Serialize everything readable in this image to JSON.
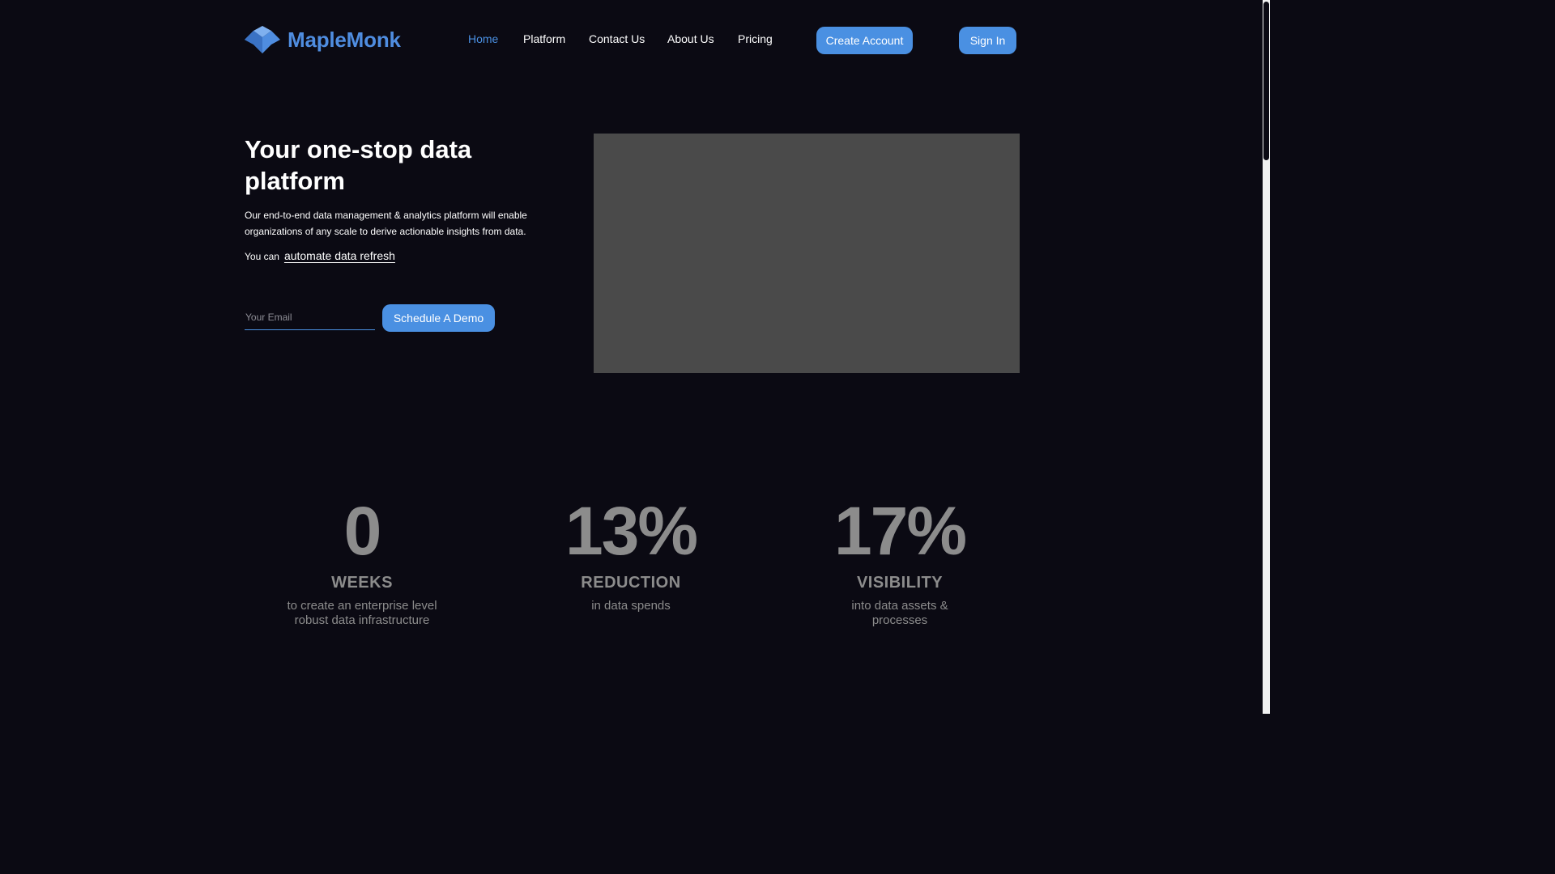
{
  "header": {
    "brand": "MapleMonk",
    "nav": [
      {
        "label": "Home",
        "active": true
      },
      {
        "label": "Platform",
        "active": false
      },
      {
        "label": "Contact Us",
        "active": false
      },
      {
        "label": "About Us",
        "active": false
      },
      {
        "label": "Pricing",
        "active": false
      }
    ],
    "create_account_label": "Create Account",
    "sign_in_label": "Sign In"
  },
  "hero": {
    "title": "Your one-stop data platform",
    "description": "Our end-to-end data management & analytics platform will enable organizations of any scale to derive actionable insights from data.",
    "can_prefix": "You can",
    "can_rotator": "automate data refresh",
    "email_placeholder": "Your Email",
    "email_value": "",
    "demo_button_label": "Schedule A Demo"
  },
  "stats": [
    {
      "value": "0",
      "label": "WEEKS",
      "desc": "to create an enterprise level robust data infrastructure"
    },
    {
      "value": "13%",
      "label": "REDUCTION",
      "desc": "in data spends"
    },
    {
      "value": "17%",
      "label": "VISIBILITY",
      "desc": "into data assets & processes"
    }
  ],
  "colors": {
    "background": "#0b0a13",
    "accent": "#4a90e2",
    "brand": "#4f8de0",
    "stat_text": "#8c8c8c",
    "media_placeholder": "#4a4a4a"
  }
}
